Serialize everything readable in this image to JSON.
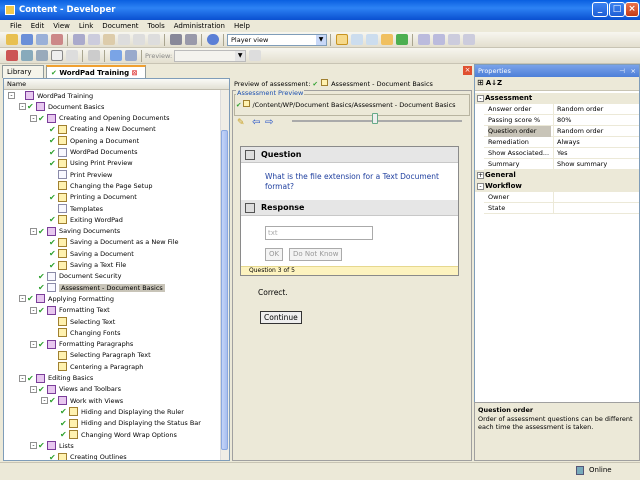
{
  "app": {
    "title": "Content - Developer"
  },
  "menu": [
    "File",
    "Edit",
    "View",
    "Link",
    "Document",
    "Tools",
    "Administration",
    "Help"
  ],
  "toolbar": {
    "view_combo": "Player view",
    "preview_label": "Preview:"
  },
  "tabs": {
    "library": "Library",
    "training": "WordPad Training"
  },
  "tree": {
    "column": "Name",
    "items": [
      {
        "label": "WordPad Training",
        "level": 0,
        "type": "book",
        "check": false,
        "pm": "-"
      },
      {
        "label": "Document Basics",
        "level": 1,
        "type": "book",
        "check": true,
        "pm": "-"
      },
      {
        "label": "Creating and Opening Documents",
        "level": 2,
        "type": "book",
        "check": true,
        "pm": "-"
      },
      {
        "label": "Creating a New Document",
        "level": 3,
        "type": "quiz",
        "check": true
      },
      {
        "label": "Opening a Document",
        "level": 3,
        "type": "quiz",
        "check": true
      },
      {
        "label": "WordPad Documents",
        "level": 3,
        "type": "page",
        "check": true
      },
      {
        "label": "Using Print Preview",
        "level": 3,
        "type": "quiz",
        "check": true
      },
      {
        "label": "Print Preview",
        "level": 3,
        "type": "page",
        "check": false
      },
      {
        "label": "Changing the Page Setup",
        "level": 3,
        "type": "quiz",
        "check": false
      },
      {
        "label": "Printing a Document",
        "level": 3,
        "type": "quiz",
        "check": true
      },
      {
        "label": "Templates",
        "level": 3,
        "type": "page",
        "check": false
      },
      {
        "label": "Exiting WordPad",
        "level": 3,
        "type": "quiz",
        "check": true
      },
      {
        "label": "Saving Documents",
        "level": 2,
        "type": "book",
        "check": true,
        "pm": "-"
      },
      {
        "label": "Saving a Document as a New File",
        "level": 3,
        "type": "quiz",
        "check": true
      },
      {
        "label": "Saving a Document",
        "level": 3,
        "type": "quiz",
        "check": true
      },
      {
        "label": "Saving a Text File",
        "level": 3,
        "type": "quiz",
        "check": true
      },
      {
        "label": "Document Security",
        "level": 2,
        "type": "page",
        "check": true
      },
      {
        "label": "Assessment - Document Basics",
        "level": 2,
        "type": "page",
        "check": true,
        "selected": true
      },
      {
        "label": "Applying Formatting",
        "level": 1,
        "type": "book",
        "check": true,
        "pm": "-"
      },
      {
        "label": "Formatting Text",
        "level": 2,
        "type": "book",
        "check": true,
        "pm": "-"
      },
      {
        "label": "Selecting Text",
        "level": 3,
        "type": "quiz",
        "check": false
      },
      {
        "label": "Changing Fonts",
        "level": 3,
        "type": "quiz",
        "check": false
      },
      {
        "label": "Formatting Paragraphs",
        "level": 2,
        "type": "book",
        "check": true,
        "pm": "-"
      },
      {
        "label": "Selecting Paragraph Text",
        "level": 3,
        "type": "quiz",
        "check": false
      },
      {
        "label": "Centering a Paragraph",
        "level": 3,
        "type": "quiz",
        "check": false
      },
      {
        "label": "Editing Basics",
        "level": 1,
        "type": "book",
        "check": true,
        "pm": "-"
      },
      {
        "label": "Views and Toolbars",
        "level": 2,
        "type": "book",
        "check": true,
        "pm": "-"
      },
      {
        "label": "Work with Views",
        "level": 3,
        "type": "book",
        "check": true,
        "pm": "-"
      },
      {
        "label": "Hiding and Displaying the Ruler",
        "level": 4,
        "type": "quiz",
        "check": true
      },
      {
        "label": "Hiding and Displaying the Status Bar",
        "level": 4,
        "type": "quiz",
        "check": true
      },
      {
        "label": "Changing Word Wrap Options",
        "level": 4,
        "type": "quiz",
        "check": true
      },
      {
        "label": "Lists",
        "level": 2,
        "type": "book",
        "check": true,
        "pm": "-"
      },
      {
        "label": "Creating Outlines",
        "level": 3,
        "type": "quiz",
        "check": true
      }
    ]
  },
  "preview": {
    "header_prefix": "Preview of assessment:",
    "header_title": "Assessment - Document Basics",
    "group_label": "Assessment Preview",
    "path": "/Content/WP/Document Basics/Assessment - Document Basics",
    "question_label": "Question",
    "question_text": "What is the file extension for a Text Document format?",
    "response_label": "Response",
    "response_value": "txt",
    "ok_label": "OK",
    "dont_know_label": "Do Not Know",
    "footer": "Question 3 of 5",
    "feedback": "Correct.",
    "continue_label": "Continue"
  },
  "properties": {
    "title": "Properties",
    "assessment": {
      "label": "Assessment",
      "rows": [
        {
          "name": "Answer order",
          "value": "Random order"
        },
        {
          "name": "Passing score %",
          "value": "80%"
        },
        {
          "name": "Question order",
          "value": "Random order"
        },
        {
          "name": "Remediation",
          "value": "Always"
        },
        {
          "name": "Show Associated...",
          "value": "Yes"
        },
        {
          "name": "Summary",
          "value": "Show summary"
        }
      ]
    },
    "general": {
      "label": "General"
    },
    "workflow": {
      "label": "Workflow",
      "rows": [
        {
          "name": "Owner",
          "value": ""
        },
        {
          "name": "State",
          "value": ""
        }
      ]
    },
    "desc_title": "Question order",
    "desc_text": "Order of assessment questions can be different each time the assessment is taken."
  },
  "status": {
    "online": "Online"
  }
}
